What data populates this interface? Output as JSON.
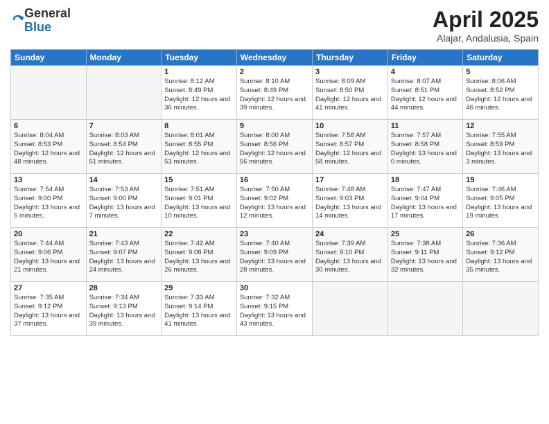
{
  "logo": {
    "general": "General",
    "blue": "Blue"
  },
  "title": "April 2025",
  "location": "Alajar, Andalusia, Spain",
  "days_of_week": [
    "Sunday",
    "Monday",
    "Tuesday",
    "Wednesday",
    "Thursday",
    "Friday",
    "Saturday"
  ],
  "weeks": [
    [
      {
        "day": "",
        "info": ""
      },
      {
        "day": "",
        "info": ""
      },
      {
        "day": "1",
        "info": "Sunrise: 8:12 AM\nSunset: 8:49 PM\nDaylight: 12 hours and 36 minutes."
      },
      {
        "day": "2",
        "info": "Sunrise: 8:10 AM\nSunset: 8:49 PM\nDaylight: 12 hours and 39 minutes."
      },
      {
        "day": "3",
        "info": "Sunrise: 8:09 AM\nSunset: 8:50 PM\nDaylight: 12 hours and 41 minutes."
      },
      {
        "day": "4",
        "info": "Sunrise: 8:07 AM\nSunset: 8:51 PM\nDaylight: 12 hours and 44 minutes."
      },
      {
        "day": "5",
        "info": "Sunrise: 8:06 AM\nSunset: 8:52 PM\nDaylight: 12 hours and 46 minutes."
      }
    ],
    [
      {
        "day": "6",
        "info": "Sunrise: 8:04 AM\nSunset: 8:53 PM\nDaylight: 12 hours and 48 minutes."
      },
      {
        "day": "7",
        "info": "Sunrise: 8:03 AM\nSunset: 8:54 PM\nDaylight: 12 hours and 51 minutes."
      },
      {
        "day": "8",
        "info": "Sunrise: 8:01 AM\nSunset: 8:55 PM\nDaylight: 12 hours and 53 minutes."
      },
      {
        "day": "9",
        "info": "Sunrise: 8:00 AM\nSunset: 8:56 PM\nDaylight: 12 hours and 56 minutes."
      },
      {
        "day": "10",
        "info": "Sunrise: 7:58 AM\nSunset: 8:57 PM\nDaylight: 12 hours and 58 minutes."
      },
      {
        "day": "11",
        "info": "Sunrise: 7:57 AM\nSunset: 8:58 PM\nDaylight: 13 hours and 0 minutes."
      },
      {
        "day": "12",
        "info": "Sunrise: 7:55 AM\nSunset: 8:59 PM\nDaylight: 13 hours and 3 minutes."
      }
    ],
    [
      {
        "day": "13",
        "info": "Sunrise: 7:54 AM\nSunset: 9:00 PM\nDaylight: 13 hours and 5 minutes."
      },
      {
        "day": "14",
        "info": "Sunrise: 7:53 AM\nSunset: 9:00 PM\nDaylight: 13 hours and 7 minutes."
      },
      {
        "day": "15",
        "info": "Sunrise: 7:51 AM\nSunset: 9:01 PM\nDaylight: 13 hours and 10 minutes."
      },
      {
        "day": "16",
        "info": "Sunrise: 7:50 AM\nSunset: 9:02 PM\nDaylight: 13 hours and 12 minutes."
      },
      {
        "day": "17",
        "info": "Sunrise: 7:48 AM\nSunset: 9:03 PM\nDaylight: 13 hours and 14 minutes."
      },
      {
        "day": "18",
        "info": "Sunrise: 7:47 AM\nSunset: 9:04 PM\nDaylight: 13 hours and 17 minutes."
      },
      {
        "day": "19",
        "info": "Sunrise: 7:46 AM\nSunset: 9:05 PM\nDaylight: 13 hours and 19 minutes."
      }
    ],
    [
      {
        "day": "20",
        "info": "Sunrise: 7:44 AM\nSunset: 9:06 PM\nDaylight: 13 hours and 21 minutes."
      },
      {
        "day": "21",
        "info": "Sunrise: 7:43 AM\nSunset: 9:07 PM\nDaylight: 13 hours and 24 minutes."
      },
      {
        "day": "22",
        "info": "Sunrise: 7:42 AM\nSunset: 9:08 PM\nDaylight: 13 hours and 26 minutes."
      },
      {
        "day": "23",
        "info": "Sunrise: 7:40 AM\nSunset: 9:09 PM\nDaylight: 13 hours and 28 minutes."
      },
      {
        "day": "24",
        "info": "Sunrise: 7:39 AM\nSunset: 9:10 PM\nDaylight: 13 hours and 30 minutes."
      },
      {
        "day": "25",
        "info": "Sunrise: 7:38 AM\nSunset: 9:11 PM\nDaylight: 13 hours and 32 minutes."
      },
      {
        "day": "26",
        "info": "Sunrise: 7:36 AM\nSunset: 9:12 PM\nDaylight: 13 hours and 35 minutes."
      }
    ],
    [
      {
        "day": "27",
        "info": "Sunrise: 7:35 AM\nSunset: 9:12 PM\nDaylight: 13 hours and 37 minutes."
      },
      {
        "day": "28",
        "info": "Sunrise: 7:34 AM\nSunset: 9:13 PM\nDaylight: 13 hours and 39 minutes."
      },
      {
        "day": "29",
        "info": "Sunrise: 7:33 AM\nSunset: 9:14 PM\nDaylight: 13 hours and 41 minutes."
      },
      {
        "day": "30",
        "info": "Sunrise: 7:32 AM\nSunset: 9:15 PM\nDaylight: 13 hours and 43 minutes."
      },
      {
        "day": "",
        "info": ""
      },
      {
        "day": "",
        "info": ""
      },
      {
        "day": "",
        "info": ""
      }
    ]
  ]
}
